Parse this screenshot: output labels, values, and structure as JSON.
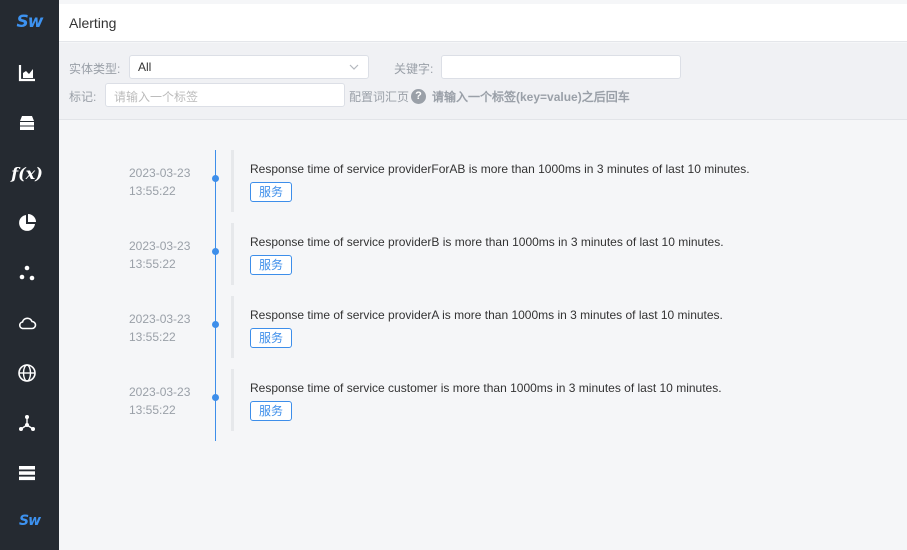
{
  "sidebar": {
    "logo_top": "Sw",
    "logo_bottom": "Sw",
    "icons": [
      "chart-icon",
      "database-icon",
      "function-icon",
      "pie-icon",
      "nodes-icon",
      "cloud-icon",
      "globe-icon",
      "topology-icon",
      "list-icon"
    ],
    "fx_label": "f(x)"
  },
  "header": {
    "title": "Alerting"
  },
  "filters": {
    "entity_type_label": "实体类型:",
    "entity_type_value": "All",
    "keyword_label": "关键字:",
    "keyword_value": "",
    "tag_label": "标记:",
    "tag_placeholder": "请输入一个标签",
    "config_link": "配置词汇页",
    "help_glyph": "?",
    "hint": "请输入一个标签(key=value)之后回车"
  },
  "alerts": [
    {
      "date": "2023-03-23",
      "time": "13:55:22",
      "message": "Response time of service providerForAB is more than 1000ms in 3 minutes of last 10 minutes.",
      "tag": "服务"
    },
    {
      "date": "2023-03-23",
      "time": "13:55:22",
      "message": "Response time of service providerB is more than 1000ms in 3 minutes of last 10 minutes.",
      "tag": "服务"
    },
    {
      "date": "2023-03-23",
      "time": "13:55:22",
      "message": "Response time of service providerA is more than 1000ms in 3 minutes of last 10 minutes.",
      "tag": "服务"
    },
    {
      "date": "2023-03-23",
      "time": "13:55:22",
      "message": "Response time of service customer is more than 1000ms in 3 minutes of last 10 minutes.",
      "tag": "服务"
    }
  ],
  "colors": {
    "sidebar": "#252a31",
    "accent": "#3d8eea"
  }
}
